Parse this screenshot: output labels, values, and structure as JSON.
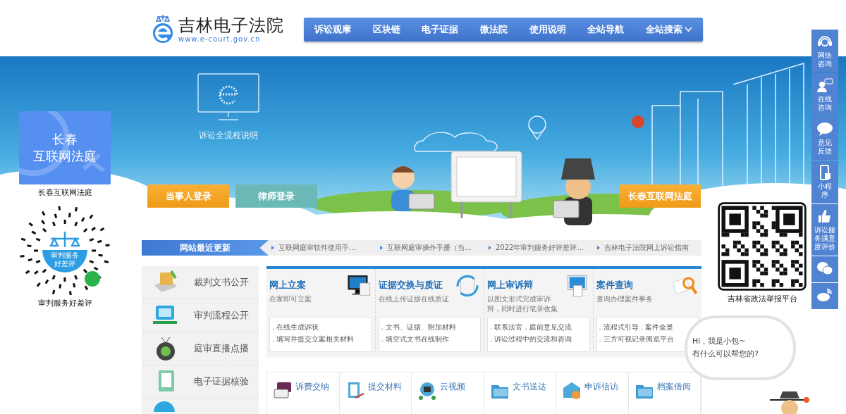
{
  "header": {
    "logo_title": "吉林电子法院",
    "logo_url": "www.e-court.gov.cn",
    "nav": [
      {
        "label": "诉讼观摩",
        "dropdown": false
      },
      {
        "label": "区块链",
        "dropdown": false
      },
      {
        "label": "电子证据",
        "dropdown": false
      },
      {
        "label": "微法院",
        "dropdown": false
      },
      {
        "label": "使用说明",
        "dropdown": false
      },
      {
        "label": "全站导航",
        "dropdown": false
      },
      {
        "label": "全站搜索",
        "dropdown": true
      }
    ]
  },
  "banner": {
    "process_link": "诉讼全流程说明",
    "buttons": [
      {
        "label": "当事人登录",
        "kind": "orange"
      },
      {
        "label": "律师登录",
        "kind": "teal"
      }
    ],
    "court_button": "长春互联网法庭"
  },
  "left_float": {
    "card_title_1": "长春",
    "card_title_2": "互联网法庭",
    "card_caption": "长春互联网法庭",
    "qr_badge": "审判服务好差评",
    "qr_caption": "审判服务好差评"
  },
  "updates": {
    "label": "网站最近更新",
    "items": [
      "互联网庭审软件使用手...",
      "互联网庭审操作手册（当...",
      "2022年审判服务好评差评...",
      "吉林电子法院网上诉讼指南"
    ]
  },
  "side_menu": [
    "裁判文书公开",
    "审判流程公开",
    "庭审直播点播",
    "电子证据核验"
  ],
  "cards": [
    {
      "title": "网上立案",
      "subtitle": "在家即可立案",
      "bullets": [
        ". 在线生成诉状",
        ". 填写并提交立案相关材料"
      ]
    },
    {
      "title": "证据交换与质证",
      "subtitle": "在线上传证据在线质证",
      "bullets": [
        ". 文书、证据、附加材料",
        ". 填空式文书在线制作"
      ]
    },
    {
      "title": "网上审诉辩",
      "subtitle": "以图文形式完成审诉辩，同时进行笔录收集",
      "bullets": [
        ". 联系法官 . 庭前意见交流",
        ". 诉讼过程中的交流和咨询"
      ]
    },
    {
      "title": "案件查询",
      "subtitle": "查询办理案件事务",
      "bullets": [
        ". 流程式引导 . 案件全景",
        ". 三方可视记录阅览平台"
      ]
    }
  ],
  "services": [
    "诉费交纳",
    "提交材料",
    "云视频",
    "文书送达",
    "申诉信访",
    "档案借阅"
  ],
  "right_float": {
    "qr_caption": "吉林省政法举报平台",
    "chat_line_1": "Hi，我是小包~",
    "chat_line_2": "有什么可以帮您的?"
  },
  "right_toolbar": [
    {
      "kind": "headset",
      "label": "网络咨询"
    },
    {
      "kind": "chat-person",
      "label": "在线咨询"
    },
    {
      "kind": "bubble",
      "label": "意见反馈"
    },
    {
      "kind": "phone",
      "label": "小程序"
    },
    {
      "kind": "thumb",
      "label": "诉讼服务满意度评价"
    },
    {
      "kind": "wechat"
    },
    {
      "kind": "weibo"
    }
  ]
}
